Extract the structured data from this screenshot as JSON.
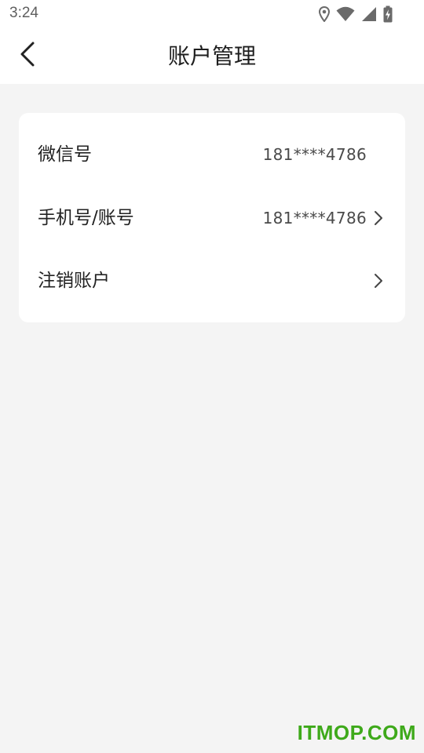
{
  "status_bar": {
    "time": "3:24",
    "icons": [
      "location-icon",
      "wifi-icon",
      "signal-icon",
      "battery-charging-icon"
    ]
  },
  "header": {
    "title": "账户管理",
    "back_icon": "chevron-left-icon"
  },
  "account_rows": [
    {
      "label": "微信号",
      "value": "181****4786",
      "has_chevron": false
    },
    {
      "label": "手机号/账号",
      "value": "181****4786",
      "has_chevron": true
    },
    {
      "label": "注销账户",
      "value": "",
      "has_chevron": true
    }
  ],
  "watermark": "ITMOP.COM",
  "colors": {
    "page_background": "#f4f4f4",
    "card_background": "#ffffff",
    "watermark": "#3ea91a"
  }
}
